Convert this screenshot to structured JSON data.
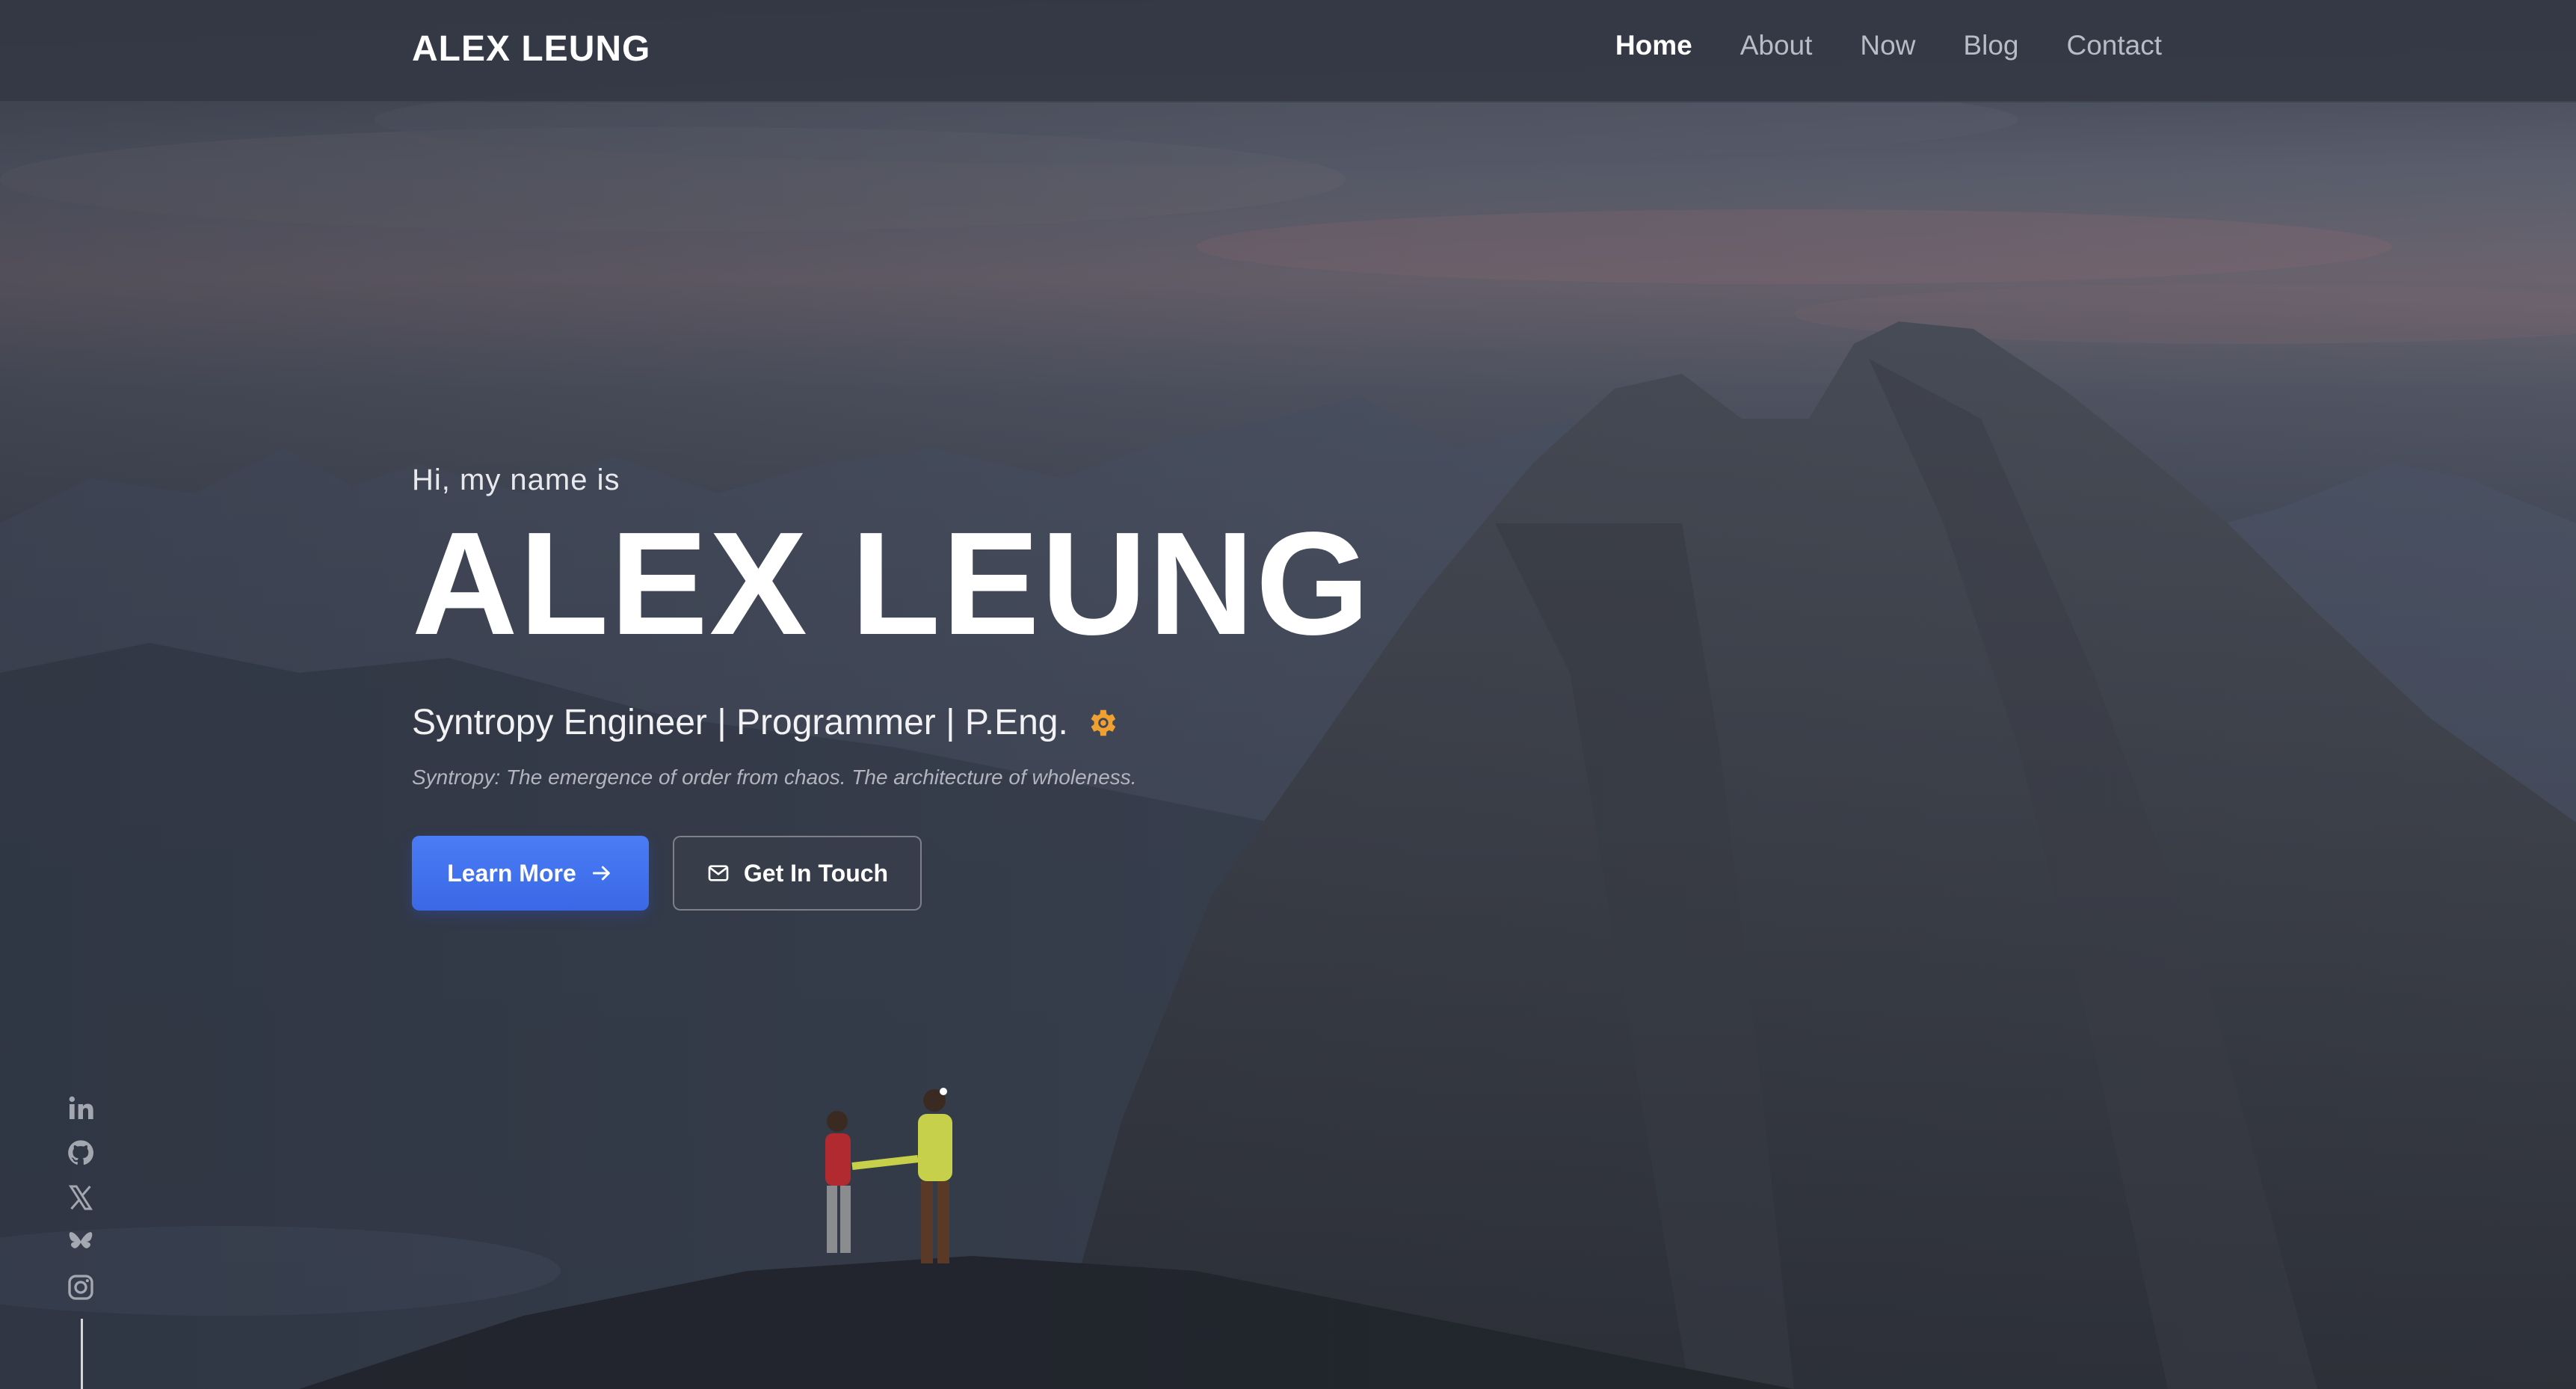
{
  "nav": {
    "brand": "ALEX LEUNG",
    "links": [
      {
        "label": "Home",
        "active": true
      },
      {
        "label": "About",
        "active": false
      },
      {
        "label": "Now",
        "active": false
      },
      {
        "label": "Blog",
        "active": false
      },
      {
        "label": "Contact",
        "active": false
      }
    ]
  },
  "hero": {
    "greeting": "Hi, my name is",
    "name": "ALEX LEUNG",
    "tagline": "Syntropy Engineer | Programmer | P.Eng.",
    "tagline_icon": "gear-icon",
    "definition": "Syntropy: The emergence of order from chaos. The architecture of wholeness.",
    "primary_button": {
      "label": "Learn More",
      "icon": "arrow-right-icon"
    },
    "secondary_button": {
      "label": "Get In Touch",
      "icon": "mail-icon"
    }
  },
  "social": [
    {
      "name": "linkedin-icon"
    },
    {
      "name": "github-icon"
    },
    {
      "name": "x-twitter-icon"
    },
    {
      "name": "bluesky-icon"
    },
    {
      "name": "instagram-icon"
    }
  ],
  "colors": {
    "accent": "#3b68e6",
    "gear": "#f0a030",
    "nav_bg": "#343844"
  }
}
